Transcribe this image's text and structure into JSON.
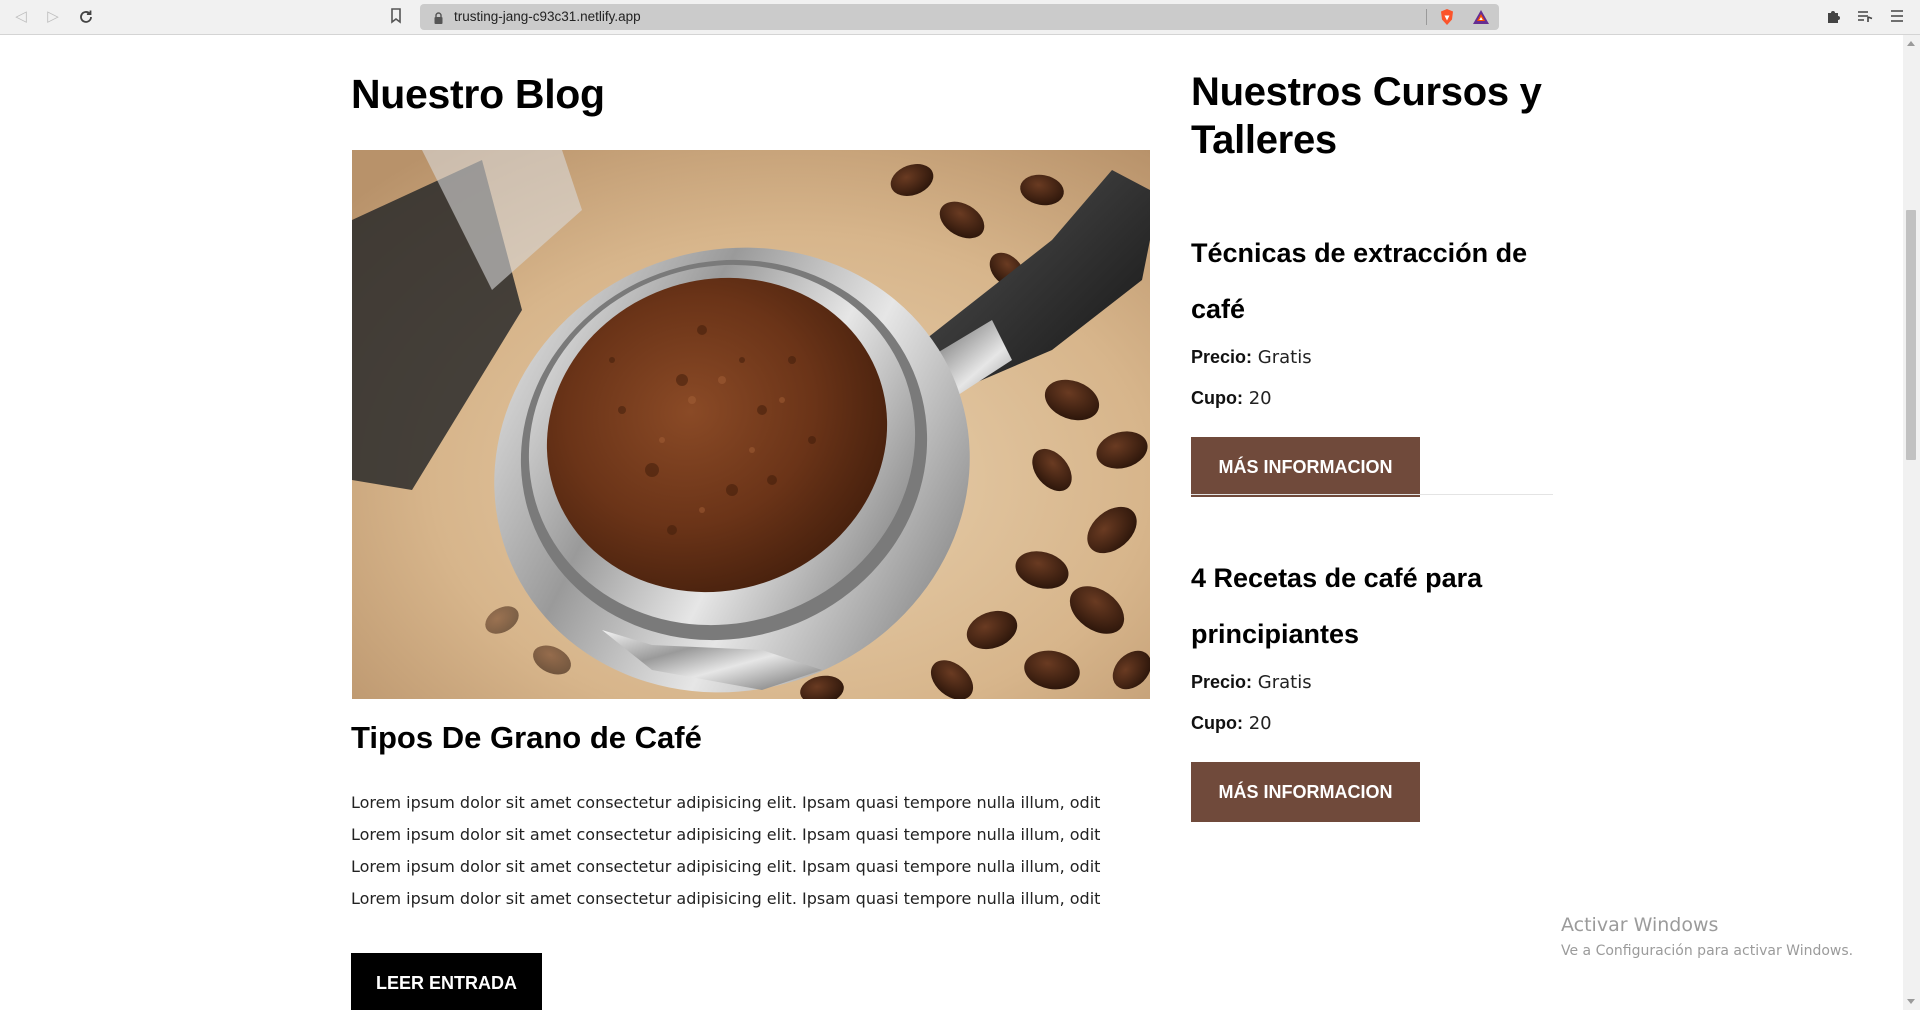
{
  "browser": {
    "url": "trusting-jang-c93c31.netlify.app",
    "icons": {
      "back": "back-arrow-icon",
      "forward": "forward-arrow-icon",
      "reload": "reload-icon",
      "bookmark": "bookmark-icon",
      "lock": "lock-icon",
      "brave_shields": "brave-shields-icon",
      "brave_rewards": "brave-rewards-icon",
      "extensions": "puzzle-extensions-icon",
      "media": "playlist-icon",
      "menu": "hamburger-menu-icon"
    },
    "colors": {
      "toolbar_bg": "#f1f1f1",
      "urlbar_bg": "#cbcbcb"
    }
  },
  "blog": {
    "heading": "Nuestro Blog",
    "post": {
      "title": "Tipos De Grano de Café",
      "excerpt": "Lorem ipsum dolor sit amet consectetur adipisicing elit. Ipsam quasi tempore nulla illum, odit Lorem ipsum dolor sit amet consectetur adipisicing elit. Ipsam quasi tempore nulla illum, odit Lorem ipsum dolor sit amet consectetur adipisicing elit. Ipsam quasi tempore nulla illum, odit Lorem ipsum dolor sit amet consectetur adipisicing elit. Ipsam quasi tempore nulla illum, odit",
      "button_label": "LEER ENTRADA"
    }
  },
  "courses": {
    "heading": "Nuestros Cursos y Talleres",
    "price_label": "Precio:",
    "spots_label": "Cupo:",
    "items": [
      {
        "title": "Técnicas de extracción de café",
        "price": "Gratis",
        "spots": "20",
        "button_label": "MÁS INFORMACION"
      },
      {
        "title": "4 Recetas de café para principiantes",
        "price": "Gratis",
        "spots": "20",
        "button_label": "MÁS INFORMACION"
      }
    ]
  },
  "windows_watermark": {
    "title": "Activar Windows",
    "subtitle": "Ve a Configuración para activar Windows."
  },
  "colors": {
    "accent_button": "#704a3b",
    "primary_button": "#000000",
    "text": "#000000"
  }
}
